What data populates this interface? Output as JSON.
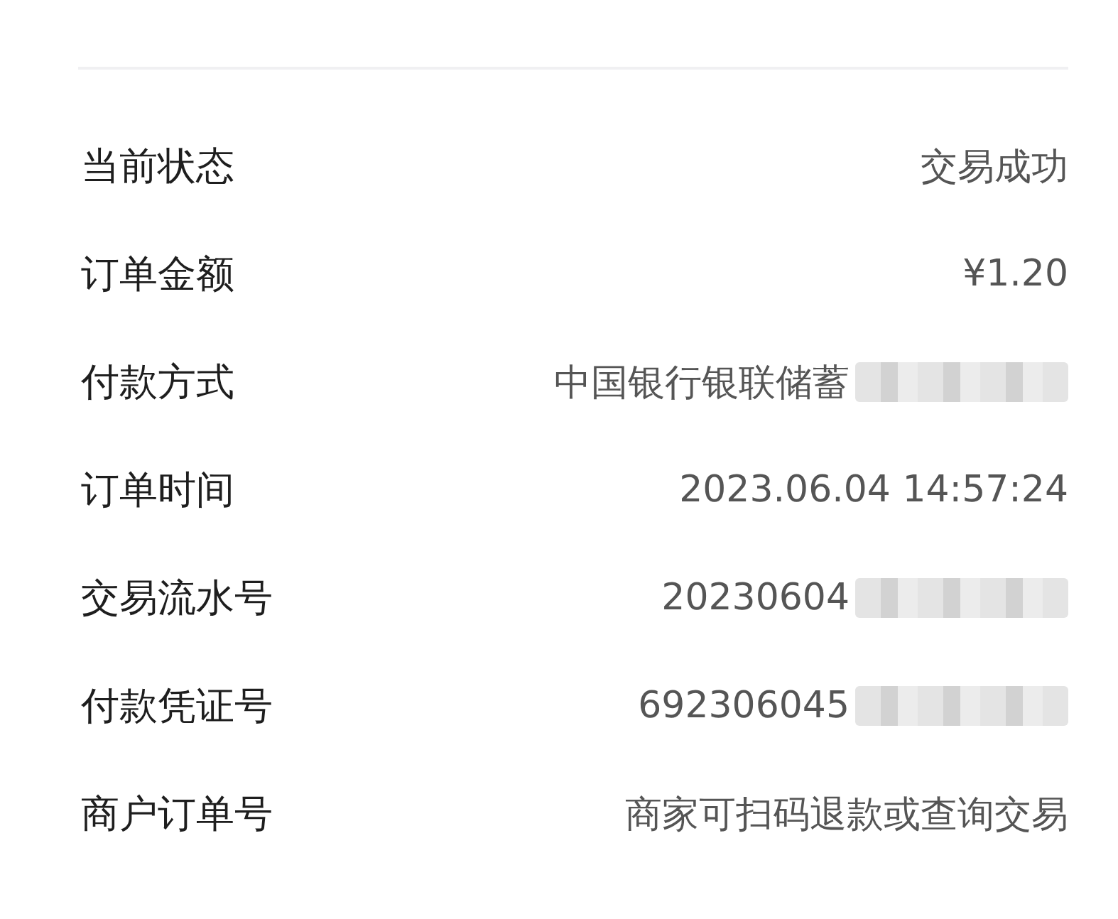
{
  "rows": [
    {
      "label": "当前状态",
      "value": "交易成功",
      "redacted": false
    },
    {
      "label": "订单金额",
      "value": "¥1.20",
      "redacted": false
    },
    {
      "label": "付款方式",
      "value": "中国银行银联储蓄",
      "redacted": true
    },
    {
      "label": "订单时间",
      "value": "2023.06.04 14:57:24",
      "redacted": false
    },
    {
      "label": "交易流水号",
      "value": "20230604",
      "redacted": true
    },
    {
      "label": "付款凭证号",
      "value": "692306045",
      "redacted": true
    },
    {
      "label": "商户订单号",
      "value": "商家可扫码退款或查询交易",
      "redacted": false
    }
  ]
}
